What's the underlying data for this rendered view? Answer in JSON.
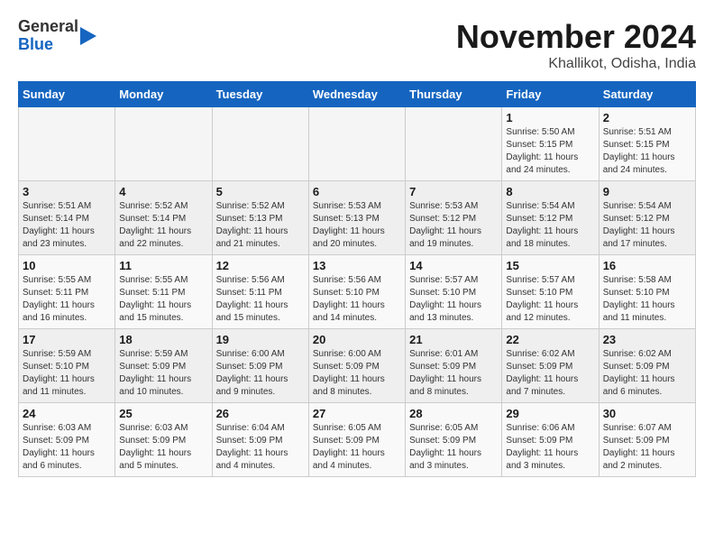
{
  "logo": {
    "general": "General",
    "blue": "Blue"
  },
  "title": "November 2024",
  "location": "Khallikot, Odisha, India",
  "weekdays": [
    "Sunday",
    "Monday",
    "Tuesday",
    "Wednesday",
    "Thursday",
    "Friday",
    "Saturday"
  ],
  "weeks": [
    [
      {
        "day": "",
        "info": ""
      },
      {
        "day": "",
        "info": ""
      },
      {
        "day": "",
        "info": ""
      },
      {
        "day": "",
        "info": ""
      },
      {
        "day": "",
        "info": ""
      },
      {
        "day": "1",
        "info": "Sunrise: 5:50 AM\nSunset: 5:15 PM\nDaylight: 11 hours\nand 24 minutes."
      },
      {
        "day": "2",
        "info": "Sunrise: 5:51 AM\nSunset: 5:15 PM\nDaylight: 11 hours\nand 24 minutes."
      }
    ],
    [
      {
        "day": "3",
        "info": "Sunrise: 5:51 AM\nSunset: 5:14 PM\nDaylight: 11 hours\nand 23 minutes."
      },
      {
        "day": "4",
        "info": "Sunrise: 5:52 AM\nSunset: 5:14 PM\nDaylight: 11 hours\nand 22 minutes."
      },
      {
        "day": "5",
        "info": "Sunrise: 5:52 AM\nSunset: 5:13 PM\nDaylight: 11 hours\nand 21 minutes."
      },
      {
        "day": "6",
        "info": "Sunrise: 5:53 AM\nSunset: 5:13 PM\nDaylight: 11 hours\nand 20 minutes."
      },
      {
        "day": "7",
        "info": "Sunrise: 5:53 AM\nSunset: 5:12 PM\nDaylight: 11 hours\nand 19 minutes."
      },
      {
        "day": "8",
        "info": "Sunrise: 5:54 AM\nSunset: 5:12 PM\nDaylight: 11 hours\nand 18 minutes."
      },
      {
        "day": "9",
        "info": "Sunrise: 5:54 AM\nSunset: 5:12 PM\nDaylight: 11 hours\nand 17 minutes."
      }
    ],
    [
      {
        "day": "10",
        "info": "Sunrise: 5:55 AM\nSunset: 5:11 PM\nDaylight: 11 hours\nand 16 minutes."
      },
      {
        "day": "11",
        "info": "Sunrise: 5:55 AM\nSunset: 5:11 PM\nDaylight: 11 hours\nand 15 minutes."
      },
      {
        "day": "12",
        "info": "Sunrise: 5:56 AM\nSunset: 5:11 PM\nDaylight: 11 hours\nand 15 minutes."
      },
      {
        "day": "13",
        "info": "Sunrise: 5:56 AM\nSunset: 5:10 PM\nDaylight: 11 hours\nand 14 minutes."
      },
      {
        "day": "14",
        "info": "Sunrise: 5:57 AM\nSunset: 5:10 PM\nDaylight: 11 hours\nand 13 minutes."
      },
      {
        "day": "15",
        "info": "Sunrise: 5:57 AM\nSunset: 5:10 PM\nDaylight: 11 hours\nand 12 minutes."
      },
      {
        "day": "16",
        "info": "Sunrise: 5:58 AM\nSunset: 5:10 PM\nDaylight: 11 hours\nand 11 minutes."
      }
    ],
    [
      {
        "day": "17",
        "info": "Sunrise: 5:59 AM\nSunset: 5:10 PM\nDaylight: 11 hours\nand 11 minutes."
      },
      {
        "day": "18",
        "info": "Sunrise: 5:59 AM\nSunset: 5:09 PM\nDaylight: 11 hours\nand 10 minutes."
      },
      {
        "day": "19",
        "info": "Sunrise: 6:00 AM\nSunset: 5:09 PM\nDaylight: 11 hours\nand 9 minutes."
      },
      {
        "day": "20",
        "info": "Sunrise: 6:00 AM\nSunset: 5:09 PM\nDaylight: 11 hours\nand 8 minutes."
      },
      {
        "day": "21",
        "info": "Sunrise: 6:01 AM\nSunset: 5:09 PM\nDaylight: 11 hours\nand 8 minutes."
      },
      {
        "day": "22",
        "info": "Sunrise: 6:02 AM\nSunset: 5:09 PM\nDaylight: 11 hours\nand 7 minutes."
      },
      {
        "day": "23",
        "info": "Sunrise: 6:02 AM\nSunset: 5:09 PM\nDaylight: 11 hours\nand 6 minutes."
      }
    ],
    [
      {
        "day": "24",
        "info": "Sunrise: 6:03 AM\nSunset: 5:09 PM\nDaylight: 11 hours\nand 6 minutes."
      },
      {
        "day": "25",
        "info": "Sunrise: 6:03 AM\nSunset: 5:09 PM\nDaylight: 11 hours\nand 5 minutes."
      },
      {
        "day": "26",
        "info": "Sunrise: 6:04 AM\nSunset: 5:09 PM\nDaylight: 11 hours\nand 4 minutes."
      },
      {
        "day": "27",
        "info": "Sunrise: 6:05 AM\nSunset: 5:09 PM\nDaylight: 11 hours\nand 4 minutes."
      },
      {
        "day": "28",
        "info": "Sunrise: 6:05 AM\nSunset: 5:09 PM\nDaylight: 11 hours\nand 3 minutes."
      },
      {
        "day": "29",
        "info": "Sunrise: 6:06 AM\nSunset: 5:09 PM\nDaylight: 11 hours\nand 3 minutes."
      },
      {
        "day": "30",
        "info": "Sunrise: 6:07 AM\nSunset: 5:09 PM\nDaylight: 11 hours\nand 2 minutes."
      }
    ]
  ]
}
